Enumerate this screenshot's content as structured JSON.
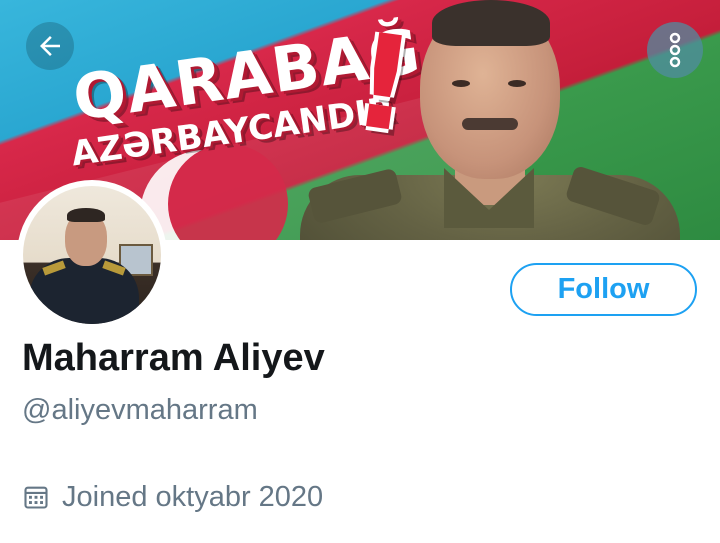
{
  "banner": {
    "slogan_line1": "QARABAĞ",
    "slogan_line2": "AZƏRBAYCANDIR",
    "slogan_mark": "!"
  },
  "nav": {
    "back_icon": "arrow-left-icon",
    "menu_icon": "more-vertical-icon"
  },
  "profile": {
    "display_name": "Maharram Aliyev",
    "handle": "@aliyevmaharram",
    "joined": "Joined oktyabr 2020",
    "joined_icon": "calendar-icon"
  },
  "actions": {
    "follow_label": "Follow"
  },
  "colors": {
    "accent": "#1da1f2",
    "text_primary": "#14171a",
    "text_secondary": "#657786"
  }
}
